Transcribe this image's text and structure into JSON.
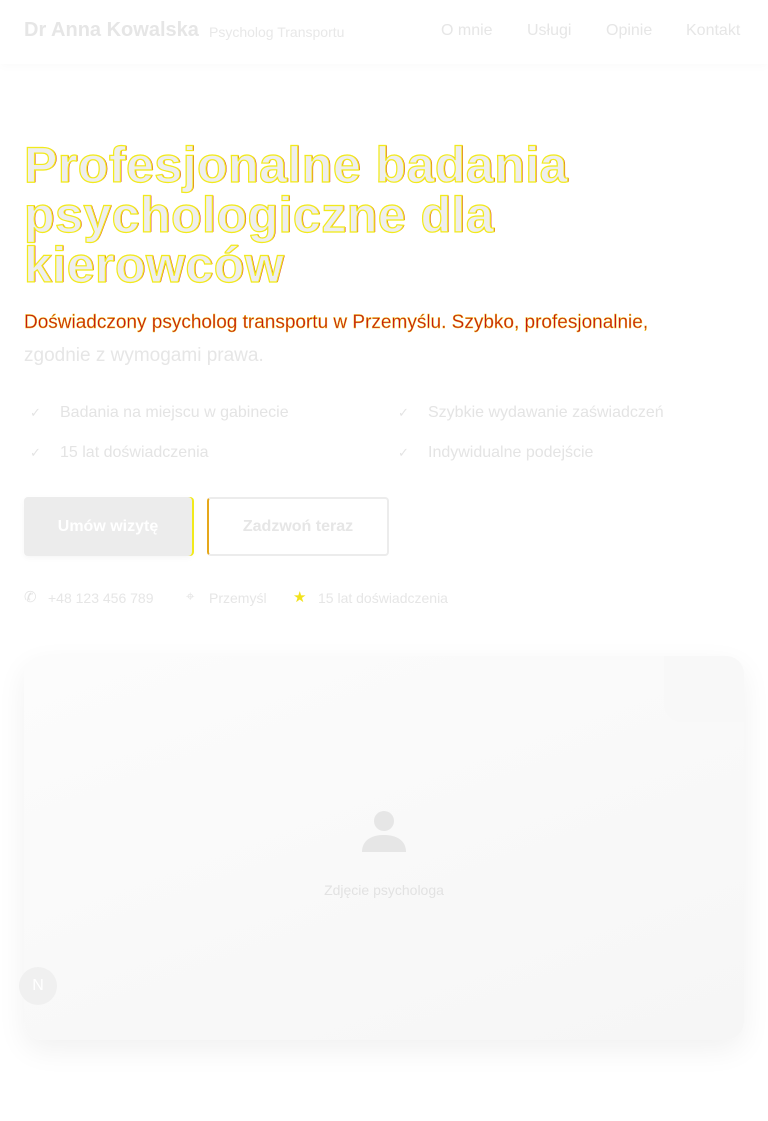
{
  "header": {
    "brand_name": "Dr Anna Kowalska",
    "tagline": "Psycholog Transportu",
    "nav": [
      "O mnie",
      "Usługi",
      "Opinie",
      "Kontakt"
    ]
  },
  "hero": {
    "title": "Profesjonalne badania psychologiczne dla kierowców",
    "subtitle_highlight": "Doświadczony psycholog transportu w Przemyślu. Szybko, profesjonalnie,",
    "subtitle_rest": "zgodnie z wymogami prawa.",
    "features": [
      "Badania na miejscu w gabinecie",
      "Szybkie wydawanie zaświadczeń",
      "15 lat doświadczenia",
      "Indywidualne podejście"
    ],
    "primary_button": "Umów wizytę",
    "secondary_button": "Zadzwoń teraz",
    "meta": {
      "phone": "+48 123 456 789",
      "location": "Przemyśl",
      "experience": "15 lat doświadczenia"
    }
  },
  "photo": {
    "label": "Zdjęcie psychologa",
    "icon": "person-icon"
  },
  "fab": {
    "label": "N"
  },
  "colors": {
    "accent_yellow": "#f2ea1c",
    "accent_red": "#c41616"
  }
}
